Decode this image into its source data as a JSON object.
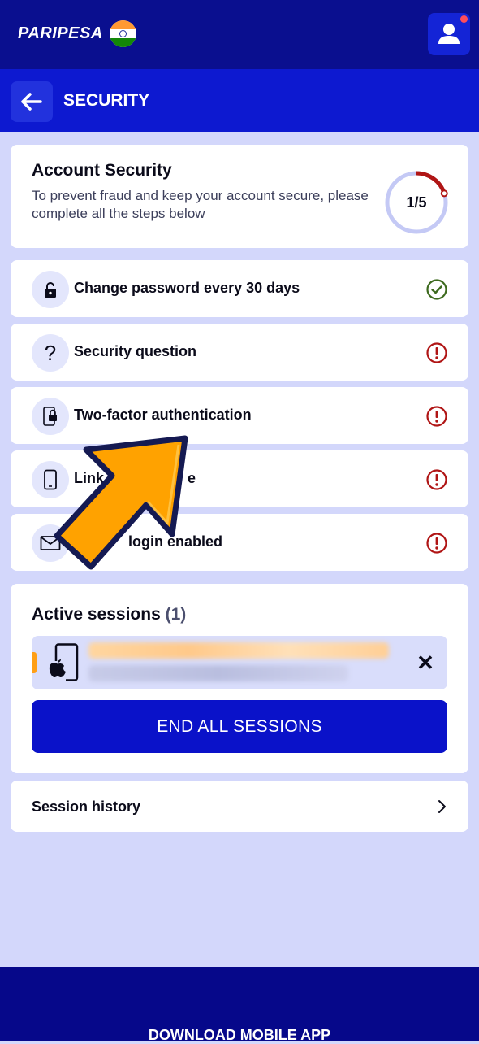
{
  "app": {
    "logo_text": "PARIPESA",
    "flag": "india-flag"
  },
  "header": {
    "back_icon": "arrow-left-icon",
    "title": "SECURITY"
  },
  "account_security": {
    "title": "Account Security",
    "subtitle": "To prevent fraud and keep your account secure, please complete all the steps below",
    "progress_label": "1/5",
    "progress_fraction": 0.2,
    "progress_color": "#b01515",
    "track_color": "#c4c9f5"
  },
  "steps": [
    {
      "label": "Change password every 30 days",
      "icon": "lock-icon",
      "status": "done"
    },
    {
      "label": "Security question",
      "icon": "question-icon",
      "status": "warning"
    },
    {
      "label": "Two-factor authentication",
      "icon": "phone-lock-icon",
      "status": "warning"
    },
    {
      "label": "Link phone",
      "visible_label": [
        "Link",
        "e"
      ],
      "icon": "phone-icon",
      "status": "warning"
    },
    {
      "label": "login enabled",
      "icon": "envelope-icon",
      "status": "warning"
    }
  ],
  "sessions": {
    "title": "Active sessions",
    "count": "(1)",
    "device_icon": "apple-device-icon",
    "end_all_label": "END ALL SESSIONS"
  },
  "session_history": {
    "label": "Session history"
  },
  "footer": {
    "label": "DOWNLOAD MOBILE APP"
  },
  "colors": {
    "brand_dark": "#0a0f8f",
    "brand": "#0d19d0",
    "check_green": "#3d6a1e",
    "warning_red": "#b01515",
    "arrow_orange": "#ffa200"
  }
}
